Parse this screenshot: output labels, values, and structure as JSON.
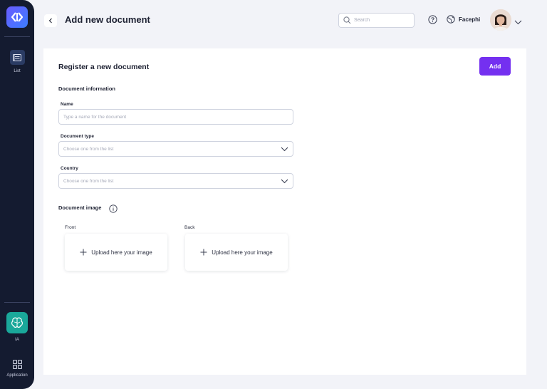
{
  "sidebar": {
    "items": [
      {
        "label": "List",
        "icon": "list-icon"
      },
      {
        "label": "IA",
        "icon": "brain-icon"
      },
      {
        "label": "Application",
        "icon": "grid-icon"
      }
    ],
    "colors": {
      "background": "#141b30",
      "ia_accent": "#1aa89a",
      "list_active": "#2a3b63"
    }
  },
  "header": {
    "title": "Add new document",
    "search_placeholder": "Search",
    "org_name": "Facephi"
  },
  "form": {
    "title": "Register a new document",
    "add_label": "Add",
    "accent_color": "#7430f0",
    "section_info": "Document information",
    "name": {
      "label": "Name",
      "placeholder": "Type a name for the document",
      "value": ""
    },
    "document_type": {
      "label": "Document type",
      "placeholder": "Choose one from the list"
    },
    "country": {
      "label": "Country",
      "placeholder": "Choose one from the list"
    },
    "section_image": "Document image",
    "front": {
      "label": "Front",
      "upload_text": "Upload here your image"
    },
    "back": {
      "label": "Back",
      "upload_text": "Upload here your image"
    }
  }
}
